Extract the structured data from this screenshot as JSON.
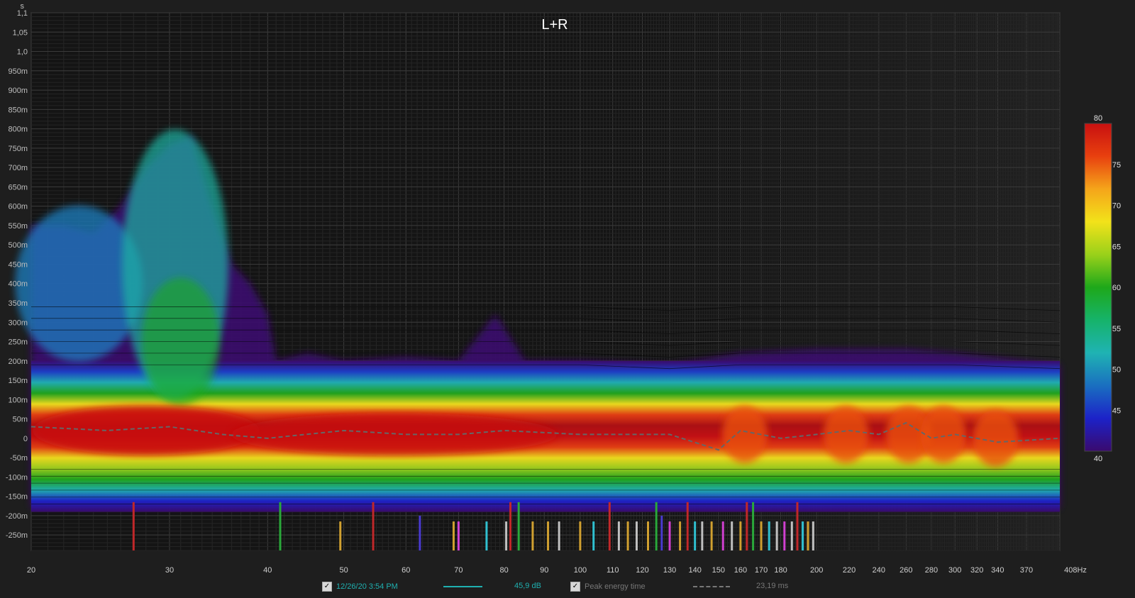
{
  "chart_data": {
    "type": "heatmap",
    "title": "L+R",
    "y_unit_label": "s",
    "x_unit_label": "Hz",
    "x_scale": "log",
    "xlim": [
      20,
      408
    ],
    "ylim": [
      -0.29,
      1.1
    ],
    "x_ticks": [
      {
        "v": 20,
        "label": "20"
      },
      {
        "v": 30,
        "label": "30"
      },
      {
        "v": 40,
        "label": "40"
      },
      {
        "v": 50,
        "label": "50"
      },
      {
        "v": 60,
        "label": "60"
      },
      {
        "v": 70,
        "label": "70"
      },
      {
        "v": 80,
        "label": "80"
      },
      {
        "v": 90,
        "label": "90"
      },
      {
        "v": 100,
        "label": "100"
      },
      {
        "v": 110,
        "label": "110"
      },
      {
        "v": 120,
        "label": "120"
      },
      {
        "v": 130,
        "label": "130"
      },
      {
        "v": 140,
        "label": "140"
      },
      {
        "v": 150,
        "label": "150"
      },
      {
        "v": 160,
        "label": "160"
      },
      {
        "v": 170,
        "label": "170"
      },
      {
        "v": 180,
        "label": "180"
      },
      {
        "v": 200,
        "label": "200"
      },
      {
        "v": 220,
        "label": "220"
      },
      {
        "v": 240,
        "label": "240"
      },
      {
        "v": 260,
        "label": "260"
      },
      {
        "v": 280,
        "label": "280"
      },
      {
        "v": 300,
        "label": "300"
      },
      {
        "v": 320,
        "label": "320"
      },
      {
        "v": 340,
        "label": "340"
      },
      {
        "v": 370,
        "label": "370"
      },
      {
        "v": 408,
        "label": "408Hz"
      }
    ],
    "y_ticks": [
      {
        "v": 1.1,
        "label": "1,1"
      },
      {
        "v": 1.05,
        "label": "1,05"
      },
      {
        "v": 1.0,
        "label": "1,0"
      },
      {
        "v": 0.95,
        "label": "950m"
      },
      {
        "v": 0.9,
        "label": "900m"
      },
      {
        "v": 0.85,
        "label": "850m"
      },
      {
        "v": 0.8,
        "label": "800m"
      },
      {
        "v": 0.75,
        "label": "750m"
      },
      {
        "v": 0.7,
        "label": "700m"
      },
      {
        "v": 0.65,
        "label": "650m"
      },
      {
        "v": 0.6,
        "label": "600m"
      },
      {
        "v": 0.55,
        "label": "550m"
      },
      {
        "v": 0.5,
        "label": "500m"
      },
      {
        "v": 0.45,
        "label": "450m"
      },
      {
        "v": 0.4,
        "label": "400m"
      },
      {
        "v": 0.35,
        "label": "350m"
      },
      {
        "v": 0.3,
        "label": "300m"
      },
      {
        "v": 0.25,
        "label": "250m"
      },
      {
        "v": 0.2,
        "label": "200m"
      },
      {
        "v": 0.15,
        "label": "150m"
      },
      {
        "v": 0.1,
        "label": "100m"
      },
      {
        "v": 0.05,
        "label": "50m"
      },
      {
        "v": 0,
        "label": "0"
      },
      {
        "v": -0.05,
        "label": "-50m"
      },
      {
        "v": -0.1,
        "label": "-100m"
      },
      {
        "v": -0.15,
        "label": "-150m"
      },
      {
        "v": -0.2,
        "label": "-200m"
      },
      {
        "v": -0.25,
        "label": "-250m"
      }
    ],
    "colorscale": {
      "min": 40,
      "max": 80,
      "labels": [
        {
          "v": 80,
          "label": "80"
        },
        {
          "v": 75,
          "label": "75"
        },
        {
          "v": 70,
          "label": "70"
        },
        {
          "v": 65,
          "label": "65"
        },
        {
          "v": 60,
          "label": "60"
        },
        {
          "v": 55,
          "label": "55"
        },
        {
          "v": 50,
          "label": "50"
        },
        {
          "v": 45,
          "label": "45"
        },
        {
          "v": 40,
          "label": "40"
        }
      ],
      "colors": [
        "#3a0a6e",
        "#1c22c8",
        "#1a6fc0",
        "#1fb3b3",
        "#16b36a",
        "#1ea81a",
        "#9ad11a",
        "#f2e21a",
        "#f5a51a",
        "#e8400f",
        "#c81010"
      ]
    },
    "decay_envelope": [
      {
        "f": 20,
        "top": 0.55
      },
      {
        "f": 22,
        "top": 0.55
      },
      {
        "f": 24,
        "top": 0.53
      },
      {
        "f": 26,
        "top": 0.6
      },
      {
        "f": 28,
        "top": 0.7
      },
      {
        "f": 30,
        "top": 0.76
      },
      {
        "f": 32,
        "top": 0.78
      },
      {
        "f": 34,
        "top": 0.6
      },
      {
        "f": 36,
        "top": 0.45
      },
      {
        "f": 38,
        "top": 0.4
      },
      {
        "f": 40,
        "top": 0.32
      },
      {
        "f": 41,
        "top": 0.2
      },
      {
        "f": 45,
        "top": 0.22
      },
      {
        "f": 50,
        "top": 0.2
      },
      {
        "f": 60,
        "top": 0.21
      },
      {
        "f": 70,
        "top": 0.2
      },
      {
        "f": 78,
        "top": 0.32
      },
      {
        "f": 85,
        "top": 0.2
      },
      {
        "f": 100,
        "top": 0.2
      },
      {
        "f": 130,
        "top": 0.19
      },
      {
        "f": 160,
        "top": 0.22
      },
      {
        "f": 200,
        "top": 0.23
      },
      {
        "f": 260,
        "top": 0.23
      },
      {
        "f": 300,
        "top": 0.22
      },
      {
        "f": 408,
        "top": 0.19
      }
    ],
    "peak_energy_time": [
      {
        "f": 20,
        "t": 0.03
      },
      {
        "f": 25,
        "t": 0.02
      },
      {
        "f": 30,
        "t": 0.03
      },
      {
        "f": 35,
        "t": 0.01
      },
      {
        "f": 40,
        "t": 0.0
      },
      {
        "f": 50,
        "t": 0.02
      },
      {
        "f": 60,
        "t": 0.01
      },
      {
        "f": 70,
        "t": 0.01
      },
      {
        "f": 80,
        "t": 0.02
      },
      {
        "f": 100,
        "t": 0.01
      },
      {
        "f": 130,
        "t": 0.01
      },
      {
        "f": 150,
        "t": -0.03
      },
      {
        "f": 160,
        "t": 0.02
      },
      {
        "f": 180,
        "t": 0.0
      },
      {
        "f": 200,
        "t": 0.01
      },
      {
        "f": 220,
        "t": 0.02
      },
      {
        "f": 240,
        "t": 0.01
      },
      {
        "f": 260,
        "t": 0.04
      },
      {
        "f": 280,
        "t": 0.0
      },
      {
        "f": 300,
        "t": 0.01
      },
      {
        "f": 340,
        "t": -0.01
      },
      {
        "f": 408,
        "t": 0.0
      }
    ],
    "modal_markers": [
      {
        "f": 27,
        "color": "#c0282a",
        "h": "tall"
      },
      {
        "f": 41.5,
        "color": "#2aa83a",
        "h": "tall"
      },
      {
        "f": 49.5,
        "color": "#d0a030",
        "h": "short"
      },
      {
        "f": 54.5,
        "color": "#c0282a",
        "h": "tall"
      },
      {
        "f": 62.5,
        "color": "#4a3ad0",
        "h": "mid"
      },
      {
        "f": 69,
        "color": "#d0a030",
        "h": "short"
      },
      {
        "f": 70,
        "color": "#d040d0",
        "h": "short"
      },
      {
        "f": 76,
        "color": "#30c0d0",
        "h": "short"
      },
      {
        "f": 80.5,
        "color": "#c0c0c0",
        "h": "short"
      },
      {
        "f": 81.5,
        "color": "#c0282a",
        "h": "tall"
      },
      {
        "f": 83.5,
        "color": "#2aa83a",
        "h": "tall"
      },
      {
        "f": 87,
        "color": "#d0a030",
        "h": "short"
      },
      {
        "f": 91,
        "color": "#d0a030",
        "h": "short"
      },
      {
        "f": 94,
        "color": "#c0c0c0",
        "h": "short"
      },
      {
        "f": 100,
        "color": "#d0a030",
        "h": "short"
      },
      {
        "f": 104,
        "color": "#30c0d0",
        "h": "short"
      },
      {
        "f": 109,
        "color": "#c0282a",
        "h": "tall"
      },
      {
        "f": 112,
        "color": "#c0c0c0",
        "h": "short"
      },
      {
        "f": 115,
        "color": "#d0a030",
        "h": "short"
      },
      {
        "f": 118,
        "color": "#c0c0c0",
        "h": "short"
      },
      {
        "f": 122,
        "color": "#d0a030",
        "h": "short"
      },
      {
        "f": 125,
        "color": "#2aa83a",
        "h": "tall"
      },
      {
        "f": 127,
        "color": "#4a3ad0",
        "h": "mid"
      },
      {
        "f": 130,
        "color": "#d040d0",
        "h": "short"
      },
      {
        "f": 134,
        "color": "#d0a030",
        "h": "short"
      },
      {
        "f": 137,
        "color": "#c0282a",
        "h": "tall"
      },
      {
        "f": 140,
        "color": "#30c0d0",
        "h": "short"
      },
      {
        "f": 143,
        "color": "#c0c0c0",
        "h": "short"
      },
      {
        "f": 147,
        "color": "#d0a030",
        "h": "short"
      },
      {
        "f": 152,
        "color": "#d040d0",
        "h": "short"
      },
      {
        "f": 156,
        "color": "#c0c0c0",
        "h": "short"
      },
      {
        "f": 160,
        "color": "#d0a030",
        "h": "short"
      },
      {
        "f": 163,
        "color": "#c0282a",
        "h": "tall"
      },
      {
        "f": 166,
        "color": "#2aa83a",
        "h": "tall"
      },
      {
        "f": 170,
        "color": "#d0a030",
        "h": "short"
      },
      {
        "f": 174,
        "color": "#30c0d0",
        "h": "short"
      },
      {
        "f": 178,
        "color": "#c0c0c0",
        "h": "short"
      },
      {
        "f": 182,
        "color": "#d040d0",
        "h": "short"
      },
      {
        "f": 186,
        "color": "#c0c0c0",
        "h": "short"
      },
      {
        "f": 189,
        "color": "#c0282a",
        "h": "tall"
      },
      {
        "f": 192,
        "color": "#30c0d0",
        "h": "short"
      },
      {
        "f": 195,
        "color": "#d0a030",
        "h": "short"
      },
      {
        "f": 198,
        "color": "#c0c0c0",
        "h": "short"
      }
    ]
  },
  "legend": {
    "measurement_label": "12/26/20 3:54 PM",
    "measurement_color": "#1fb0b0",
    "measurement_value": "45,9 dB",
    "peak_label": "Peak energy time",
    "peak_value": "23,19 ms",
    "check_glyph": "✓"
  }
}
